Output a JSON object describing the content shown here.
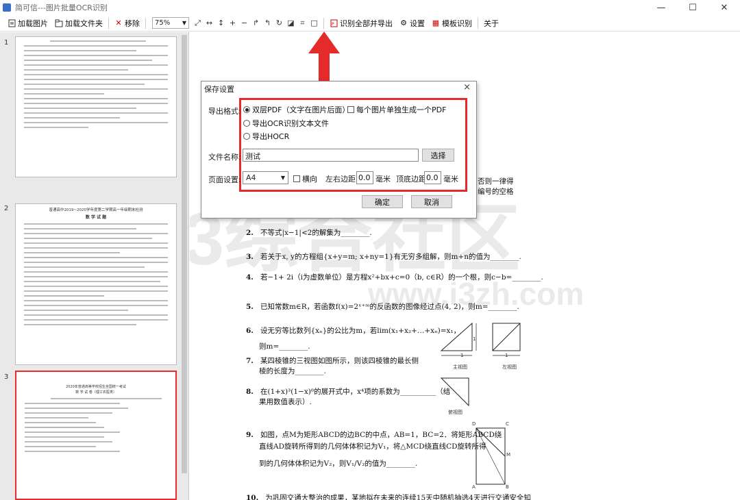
{
  "window": {
    "title": "简可信---图片批量OCR识别",
    "minimize": "—",
    "maximize": "☐",
    "close": "✕"
  },
  "toolbar": {
    "load_image": "加载图片",
    "load_folder": "加载文件夹",
    "remove": "移除",
    "zoom": "75%",
    "ocr_export_all": "识别全部并导出",
    "settings": "设置",
    "template_ocr": "模板识别",
    "about": "关于"
  },
  "thumbnails": {
    "pages": [
      "1",
      "2",
      "3"
    ],
    "selected_page": "3",
    "page2_heading": "普通高中2019~2020学年度第二学期高一年级期末检测",
    "page2_subheading": "数 学 试 题",
    "page3_heading": "2020年普通高等学校招生全国统一考试",
    "page3_subheading": "数 学 试 卷（理工农医类）"
  },
  "document": {
    "partial_line_1": "否则一律得",
    "partial_line_2": "编号的空格",
    "questions": [
      {
        "n": "2.",
        "text": "不等式|x−1|<2的解集为________."
      },
      {
        "n": "3.",
        "text": "若关于x, y的方程组{x+y=m; x+ny=1}有无穷多组解，则m+n的值为________."
      },
      {
        "n": "4.",
        "text": "若−1+ 2i（i为虚数单位）是方程x²+bx+c=0（b, c∈R）的一个根，则c−b=________."
      },
      {
        "n": "5.",
        "text": "已知常数m∈R，若函数f(x)=2ˣ⁺ᵐ的反函数的图像经过点(4, 2)，则m=________."
      },
      {
        "n": "6.",
        "text": "设无穷等比数列{xₙ}的公比为m，若lim(x₁+x₂+…+xₙ)=x₁，"
      },
      {
        "n": "",
        "text": "则m=________."
      },
      {
        "n": "7.",
        "text": "某四棱锥的三视图如图所示，则该四棱锥的最长侧"
      },
      {
        "n": "",
        "text": "棱的长度为________."
      },
      {
        "n": "8.",
        "text": "在(1+x)³(1−x)⁸的展开式中，x⁴项的系数为__________（结"
      },
      {
        "n": "",
        "text": "果用数值表示）."
      },
      {
        "n": "9.",
        "text": "如图，点M为矩形ABCD的边BC的中点，AB=1，BC=2．将矩形ABCD绕"
      },
      {
        "n": "",
        "text": "直线AD旋转所得到的几何体体积记为V₁，将△MCD绕直线CD旋转所得"
      },
      {
        "n": "",
        "text": "到的几何体体积记为V₂，则V₁/V₂的值为________."
      },
      {
        "n": "10.",
        "text": "为巩固交通大整治的成果，某地拟在未来的连续15天中随机抽选4天进行交通安全知"
      }
    ],
    "fig_front": "主视图",
    "fig_left": "左视图",
    "fig_top": "俯视图",
    "fig_dim": "1",
    "rect_labels": [
      "D",
      "C",
      "M",
      "A",
      "B"
    ],
    "watermark_main": "i3综合社区",
    "watermark_url": "www.i3zh.com"
  },
  "dialog": {
    "title": "保存设置",
    "close": "×",
    "export_format_label": "导出格式:",
    "option_dual_pdf": "双层PDF（文字在图片后面）",
    "option_each_pdf": "每个图片单独生成一个PDF",
    "option_ocr_text": "导出OCR识别文本文件",
    "option_hocr": "导出HOCR",
    "filename_label": "文件名称:",
    "filename_value": "测试",
    "browse_button": "选择",
    "page_setup_label": "页面设置:",
    "page_size": "A4",
    "landscape": "横向",
    "lr_margin_label": "左右边距",
    "lr_margin_value": "0.0",
    "lr_unit": "毫米",
    "tb_margin_label": "顶底边距",
    "tb_margin_value": "0.0",
    "tb_unit": "毫米",
    "ok": "确定",
    "cancel": "取消"
  },
  "colors": {
    "highlight_red": "#e52a2a",
    "panel_gray": "#e9e9e9"
  }
}
